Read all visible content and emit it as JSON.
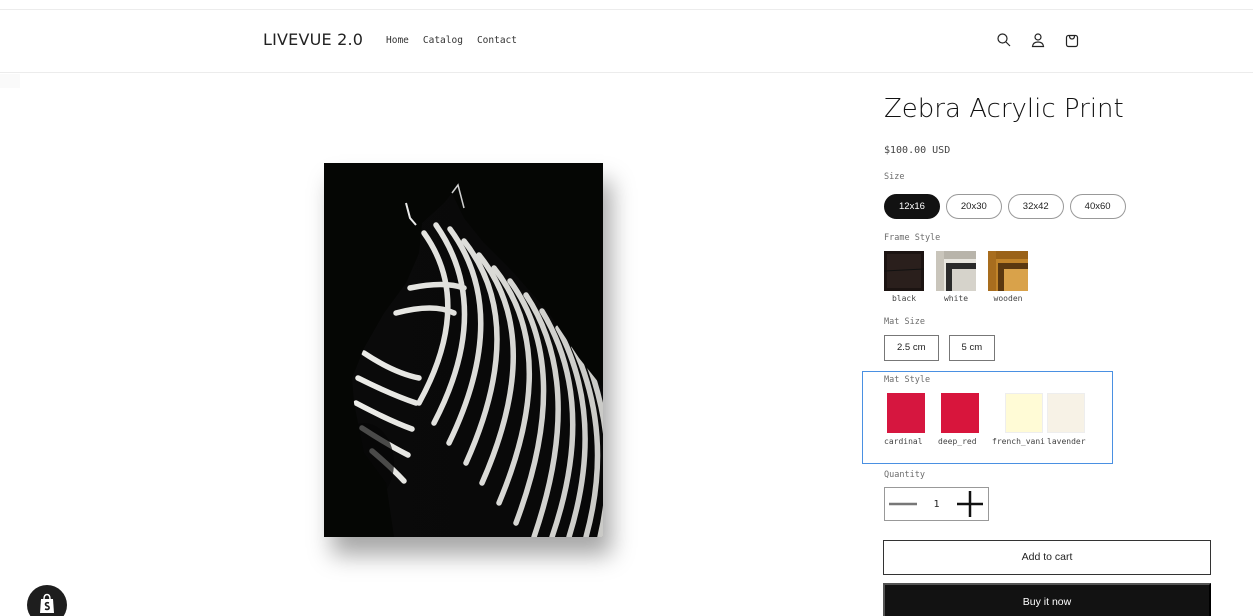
{
  "header": {
    "logo": "LIVEVUE 2.0",
    "nav": [
      "Home",
      "Catalog",
      "Contact"
    ],
    "icons": [
      "search-icon",
      "account-icon",
      "cart-icon"
    ]
  },
  "product": {
    "title": "Zebra Acrylic Print",
    "price": "$100.00 USD",
    "image": "zebra-photo"
  },
  "size": {
    "label": "Size",
    "options": [
      "12x16",
      "20x30",
      "32x42",
      "40x60"
    ],
    "selected": "12x16"
  },
  "frame_style": {
    "label": "Frame Style",
    "options": [
      "black",
      "white",
      "wooden"
    ]
  },
  "mat_size": {
    "label": "Mat Size",
    "options": [
      "2.5 cm",
      "5 cm"
    ]
  },
  "mat_style": {
    "label": "Mat Style",
    "options": [
      "cardinal",
      "deep_red",
      "french_vani",
      "lavender"
    ],
    "colors": [
      "#d6163f",
      "#d8153c",
      "#fffbd6",
      "#f7f2e6"
    ],
    "highlight_color": "#4a90e2"
  },
  "quantity": {
    "label": "Quantity",
    "value": "1"
  },
  "actions": {
    "add_to_cart": "Add to cart",
    "buy_now": "Buy it now"
  }
}
